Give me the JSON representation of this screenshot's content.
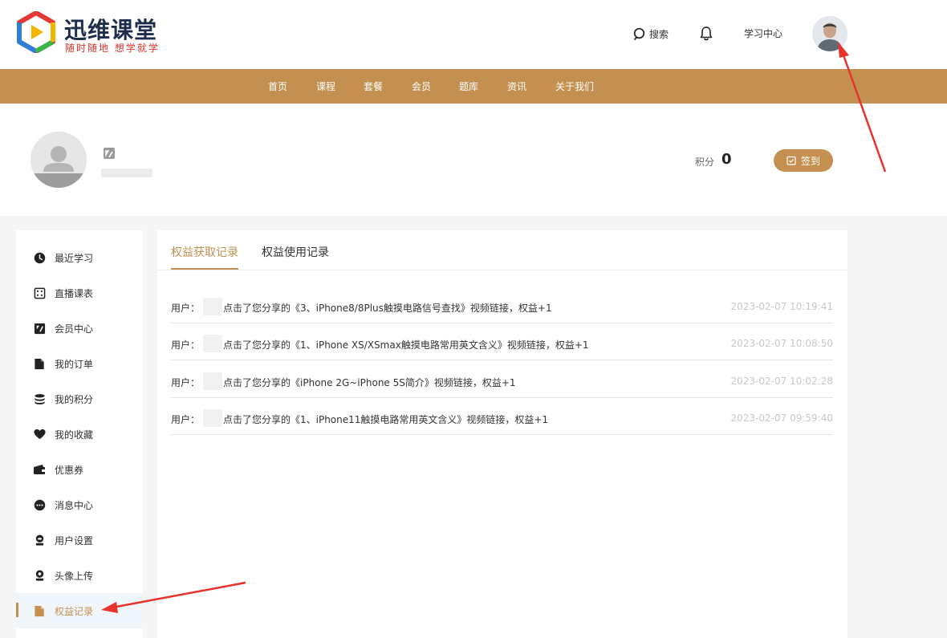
{
  "header": {
    "logo_title": "迅维课堂",
    "logo_slogan": "随时随地 想学就学",
    "search_label": "搜索",
    "study_center_label": "学习中心",
    "icons": {
      "search": "search-icon",
      "bell": "bell-icon",
      "avatar": "user-avatar"
    }
  },
  "nav": {
    "items": [
      "首页",
      "课程",
      "套餐",
      "会员",
      "题库",
      "资讯",
      "关于我们"
    ]
  },
  "profile": {
    "points_label": "积分",
    "points_value": "0",
    "sign_label": "签到"
  },
  "sidebar": {
    "items": [
      {
        "label": "最近学习",
        "icon": "clock-icon"
      },
      {
        "label": "直播课表",
        "icon": "calendar-icon"
      },
      {
        "label": "会员中心",
        "icon": "vip-icon"
      },
      {
        "label": "我的订单",
        "icon": "document-icon"
      },
      {
        "label": "我的积分",
        "icon": "coins-icon"
      },
      {
        "label": "我的收藏",
        "icon": "heart-icon"
      },
      {
        "label": "优惠券",
        "icon": "wallet-icon"
      },
      {
        "label": "消息中心",
        "icon": "chat-icon"
      },
      {
        "label": "用户设置",
        "icon": "user-icon"
      },
      {
        "label": "头像上传",
        "icon": "avatar-upload-icon"
      },
      {
        "label": "权益记录",
        "icon": "record-icon",
        "active": true
      }
    ]
  },
  "tabs": {
    "items": [
      "权益获取记录",
      "权益使用记录"
    ],
    "active": 0
  },
  "records": [
    {
      "user_label": "用户：",
      "text": "点击了您分享的《3、iPhone8/8Plus触摸电路信号查找》视频链接，权益+1",
      "time": "2023-02-07 10:19:41"
    },
    {
      "user_label": "用户：",
      "text": "点击了您分享的《1、iPhone XS/XSmax触摸电路常用英文含义》视频链接，权益+1",
      "time": "2023-02-07 10:08:50"
    },
    {
      "user_label": "用户：",
      "text": "点击了您分享的《iPhone 2G~iPhone 5S简介》视频链接，权益+1",
      "time": "2023-02-07 10:02:28"
    },
    {
      "user_label": "用户：",
      "text": "点击了您分享的《1、iPhone11触摸电路常用英文含义》视频链接，权益+1",
      "time": "2023-02-07 09:59:40"
    }
  ],
  "colors": {
    "accent": "#c39050",
    "annotation_arrow": "#e8322c",
    "logo_dark": "#1f2d4d",
    "logo_red": "#d9342b"
  }
}
